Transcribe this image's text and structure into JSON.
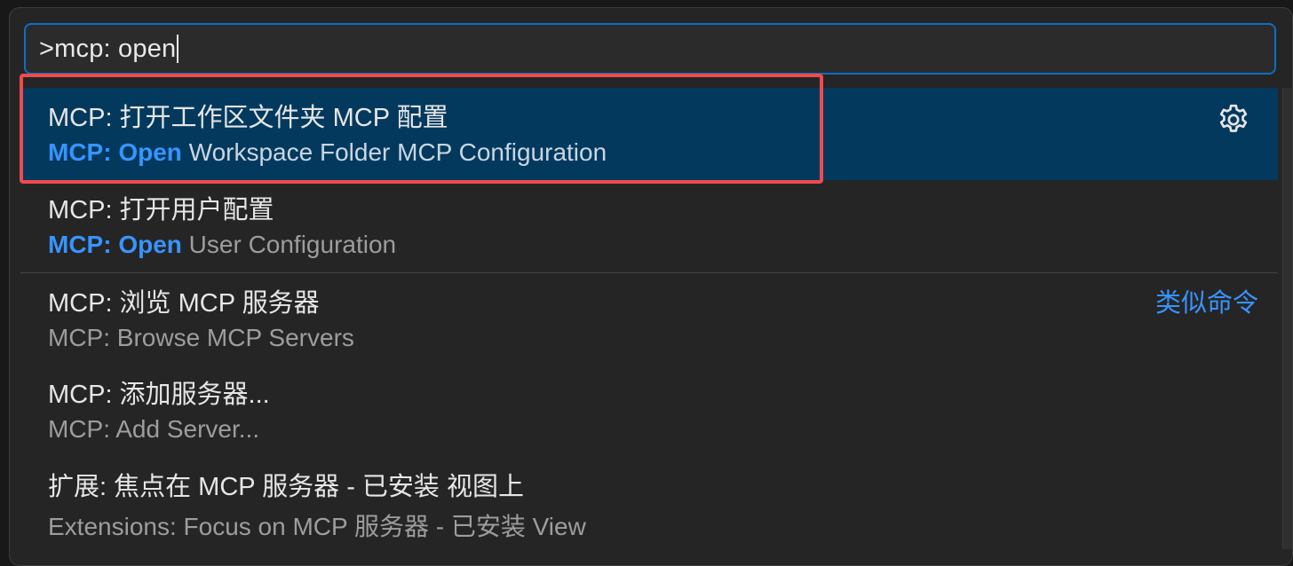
{
  "input": {
    "value": ">mcp: open"
  },
  "items": [
    {
      "line1": "MCP: 打开工作区文件夹 MCP 配置",
      "line2_highlight": "MCP: Open",
      "line2_rest": " Workspace Folder MCP Configuration",
      "action_icon": "gear-icon"
    },
    {
      "line1": "MCP: 打开用户配置",
      "line2_highlight": "MCP: Open",
      "line2_rest": " User Configuration"
    },
    {
      "line1": "MCP: 浏览 MCP 服务器",
      "line2": "MCP: Browse MCP Servers",
      "side_label": "类似命令"
    },
    {
      "line1": "MCP: 添加服务器...",
      "line2": "MCP: Add Server..."
    },
    {
      "line1": "扩展: 焦点在 MCP 服务器 - 已安装 视图上",
      "line2": "Extensions: Focus on MCP 服务器 - 已安装 View"
    }
  ],
  "colors": {
    "accent": "#3794ff",
    "selected_bg": "#04395e",
    "focus_border": "#0e6fc2",
    "annotation_border": "#ef4b4f"
  }
}
